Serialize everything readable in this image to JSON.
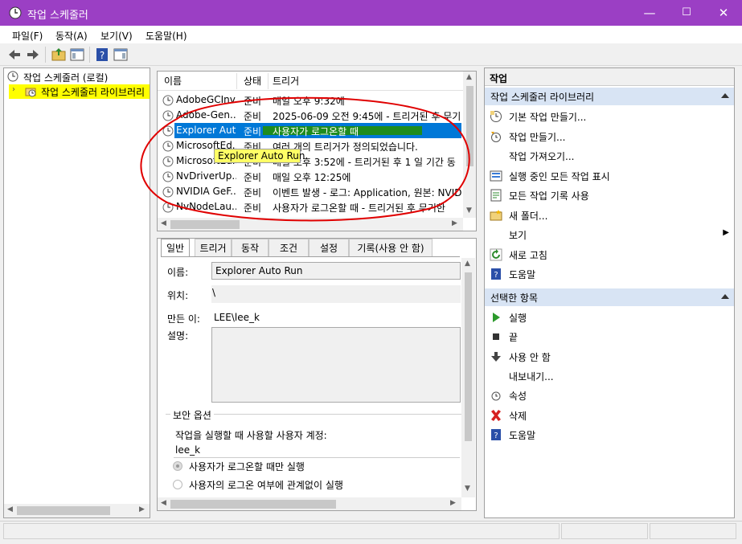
{
  "window": {
    "title": "작업 스케줄러",
    "minimize": "—",
    "maximize": "☐",
    "close": "✕"
  },
  "menu": [
    "파일(F)",
    "동작(A)",
    "보기(V)",
    "도움말(H)"
  ],
  "tree": {
    "root": "작업 스케줄러 (로컬)",
    "library": "작업 스케줄러 라이브러리"
  },
  "task_list": {
    "columns": [
      "이름",
      "상태",
      "트리거"
    ],
    "rows": [
      {
        "name": "AdobeGCInv...",
        "status": "준비",
        "trigger": "매일 오후 9:32에"
      },
      {
        "name": "Adobe-Gen...",
        "status": "준비",
        "trigger": "2025-06-09 오전 9:45에 - 트리거된 후 무기"
      },
      {
        "name": "Explorer Aut...",
        "status": "준비",
        "trigger": "사용자가 로그온할 때"
      },
      {
        "name": "MicrosoftEd...",
        "status": "준비",
        "trigger": "여러 개의 트리거가 정의되었습니다."
      },
      {
        "name": "MicrosoftEd...",
        "status": "준비",
        "trigger": "매일 오후 3:52에 - 트리거된 후 1 일 기간 동"
      },
      {
        "name": "NvDriverUp...",
        "status": "준비",
        "trigger": "매일 오후 12:25에"
      },
      {
        "name": "NVIDIA GeF...",
        "status": "준비",
        "trigger": "이벤트 발생 - 로그: Application, 원본: NVID"
      },
      {
        "name": "NvNodeLau...",
        "status": "준비",
        "trigger": "사용자가 로그온할 때 - 트리거된 후 무기한"
      }
    ],
    "tooltip": "Explorer Auto Run"
  },
  "detail": {
    "tabs": [
      "일반",
      "트리거",
      "동작",
      "조건",
      "설정",
      "기록(사용 안 함)"
    ],
    "name_label": "이름:",
    "name_value": "Explorer Auto Run",
    "location_label": "위치:",
    "location_value": "\\",
    "author_label": "만든 이:",
    "author_value": "LEE\\lee_k",
    "desc_label": "설명:",
    "security_title": "보안 옵션",
    "account_label": "작업을 실행할 때 사용할 사용자 계정:",
    "account_value": "lee_k",
    "radio1": "사용자가 로그온할 때만 실행",
    "radio2": "사용자의 로그온 여부에 관계없이 실행"
  },
  "actions": {
    "header": "작업",
    "section1": "작업 스케줄러 라이브러리",
    "items1": [
      "기본 작업 만들기...",
      "작업 만들기...",
      "작업 가져오기...",
      "실행 중인 모든 작업 표시",
      "모든 작업 기록 사용",
      "새 폴더...",
      "보기",
      "새로 고침",
      "도움말"
    ],
    "section2": "선택한 항목",
    "items2": [
      "실행",
      "끝",
      "사용 안 함",
      "내보내기...",
      "속성",
      "삭제",
      "도움말"
    ]
  },
  "colors": {
    "titlebar": "#9b3fc4",
    "selection": "#0078d7",
    "highlight_yellow": "#ffff00",
    "annotation_red": "#e00000",
    "annotation_green": "#1e8c1e"
  }
}
